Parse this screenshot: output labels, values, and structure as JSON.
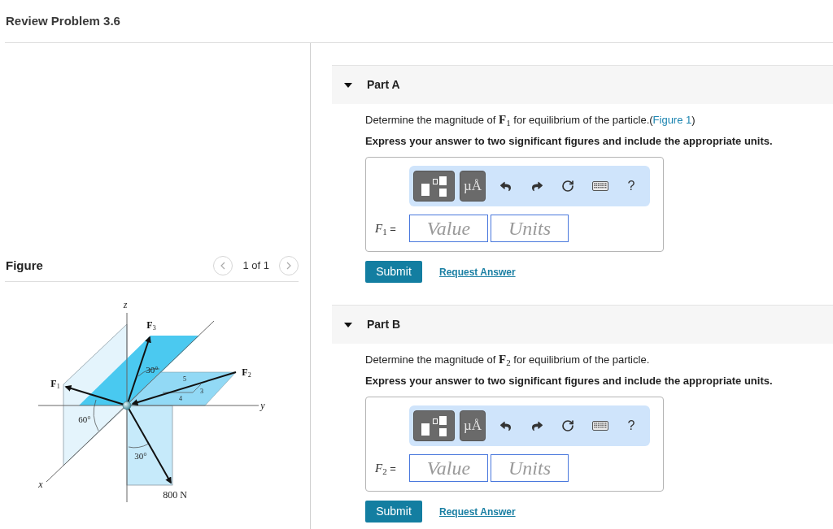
{
  "header": {
    "title": "Review Problem 3.6"
  },
  "figure_panel": {
    "title": "Figure",
    "pager": "1 of 1",
    "diagram": {
      "axes": [
        "z",
        "y",
        "x"
      ],
      "forces": [
        "F$_{3}$",
        "F$_{2}$",
        "F$_{1}$"
      ],
      "angles": [
        "30°",
        "60°",
        "30°"
      ],
      "slope": [
        "5",
        "3",
        "4"
      ],
      "load": "800 N"
    }
  },
  "parts": [
    {
      "title": "Part A",
      "expanded": true,
      "question": {
        "text": "Determine the magnitude of **F**$_{1}$ for equilibrium of the particle.(",
        "link": "Figure 1",
        "text_after": ")"
      },
      "instruction": "Express your answer to two significant figures and include the appropriate units.",
      "toolbar": [
        {
          "kind": "templates"
        },
        {
          "kind": "units",
          "text": "µÅ"
        },
        {
          "kind": "undo"
        },
        {
          "kind": "redo"
        },
        {
          "kind": "reset"
        },
        {
          "kind": "keyboard"
        },
        {
          "kind": "help",
          "text": "?"
        }
      ],
      "answer": {
        "label": "*F*$_{1}$ =",
        "value_placeholder": "Value",
        "units_placeholder": "Units"
      },
      "submit": "Submit",
      "request": "Request Answer"
    },
    {
      "title": "Part B",
      "expanded": true,
      "question": {
        "text": "Determine the magnitude of **F**$_{2}$ for equilibrium of the particle."
      },
      "instruction": "Express your answer to two significant figures and include the appropriate units.",
      "toolbar": [
        {
          "kind": "templates"
        },
        {
          "kind": "units",
          "text": "µÅ"
        },
        {
          "kind": "undo"
        },
        {
          "kind": "redo"
        },
        {
          "kind": "reset"
        },
        {
          "kind": "keyboard"
        },
        {
          "kind": "help",
          "text": "?"
        }
      ],
      "answer": {
        "label": "*F*$_{2}$ =",
        "value_placeholder": "Value",
        "units_placeholder": "Units"
      },
      "submit": "Submit",
      "request": "Request Answer"
    }
  ]
}
